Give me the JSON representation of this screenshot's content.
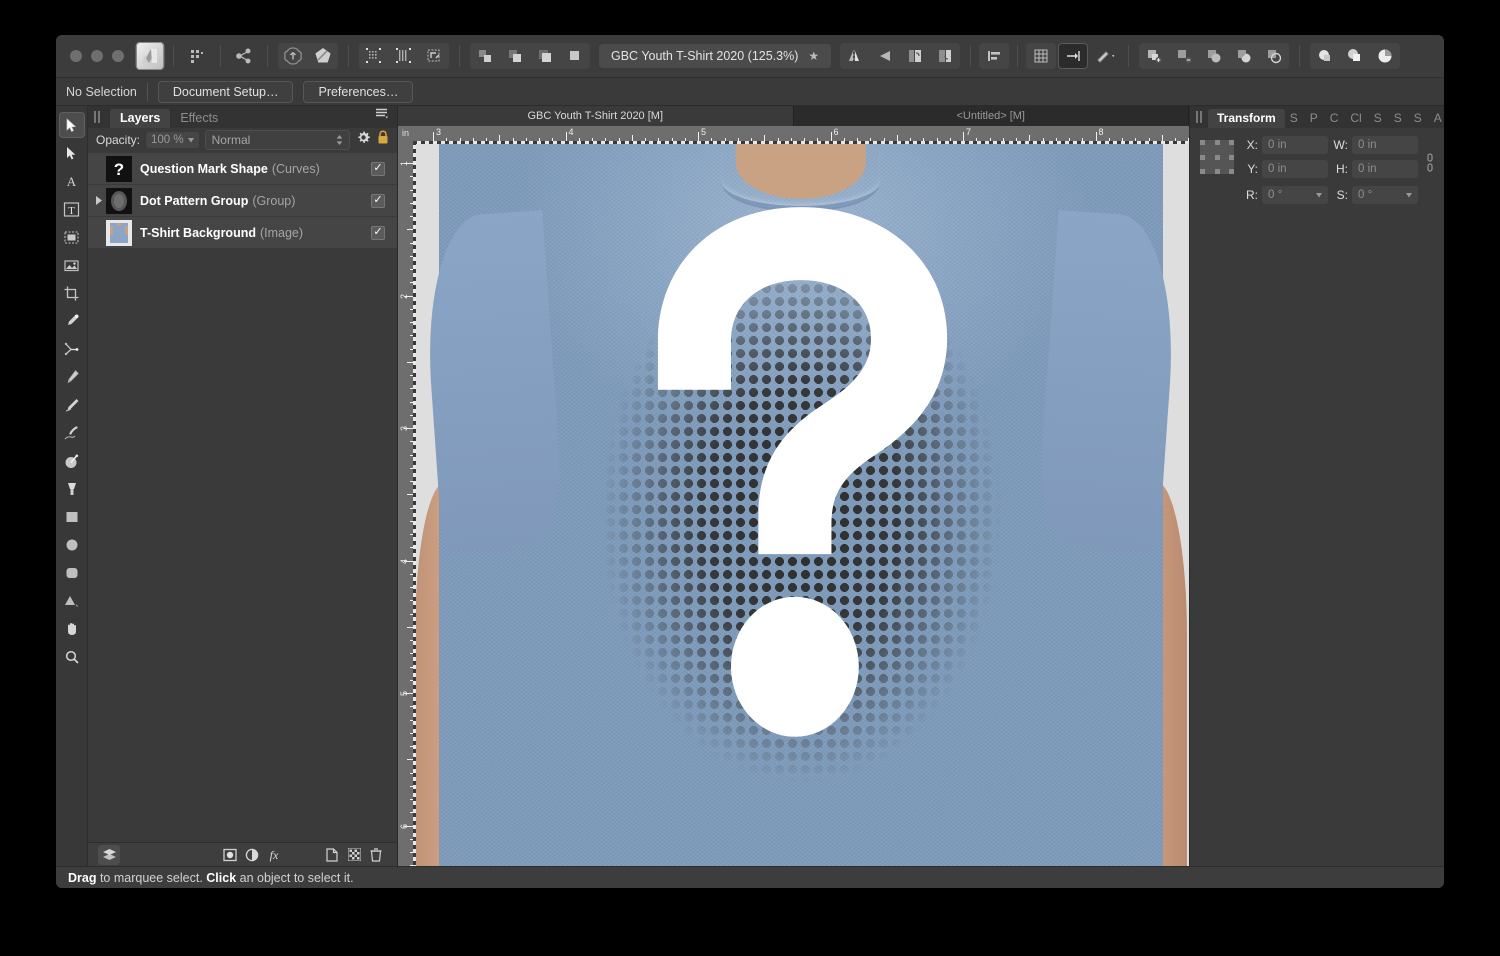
{
  "app": {
    "window_buttons": [
      "close",
      "minimize",
      "maximize"
    ],
    "logo": "affinity-photo-logo"
  },
  "titlebar": {
    "document_title": "GBC Youth T-Shirt 2020 (125.3%)",
    "modified_marker": "★",
    "tools": [
      {
        "name": "assistant-manager-icon",
        "label": "Assistant Manager"
      },
      {
        "name": "share-icon",
        "label": "Share"
      },
      {
        "name": "pixel-persona-icon",
        "label": "Pixel Persona"
      },
      {
        "name": "develop-persona-icon",
        "label": "Develop Persona"
      },
      {
        "name": "select-sampled-color-icon",
        "label": "Select Sampled Colour"
      },
      {
        "name": "refine-selection-icon",
        "label": "Refine Selection"
      },
      {
        "name": "selection-transform-icon",
        "label": "Transform Selection"
      },
      {
        "name": "boolean-add-icon",
        "label": "Add"
      },
      {
        "name": "boolean-subtract-icon",
        "label": "Subtract"
      },
      {
        "name": "boolean-intersect-icon",
        "label": "Intersect"
      },
      {
        "name": "boolean-xor-icon",
        "label": "Xor"
      },
      {
        "name": "flip-horizontal-icon",
        "label": "Flip Horizontal"
      },
      {
        "name": "flip-vertical-icon",
        "label": "Flip Vertical"
      },
      {
        "name": "rotate-ccw-icon",
        "label": "Rotate Left"
      },
      {
        "name": "rotate-cw-icon",
        "label": "Rotate Right"
      },
      {
        "name": "alignment-icon",
        "label": "Alignment"
      },
      {
        "name": "grid-snapping-icon",
        "label": "Show Grid"
      },
      {
        "name": "snapping-icon",
        "label": "Enable Snapping"
      },
      {
        "name": "snapping-options-icon",
        "label": "Snapping Options"
      },
      {
        "name": "geometry-add-icon",
        "label": "Add"
      },
      {
        "name": "geometry-subtract-icon",
        "label": "Subtract"
      },
      {
        "name": "geometry-intersect-icon",
        "label": "Intersect"
      },
      {
        "name": "geometry-divide-icon",
        "label": "Divide"
      },
      {
        "name": "geometry-combine-icon",
        "label": "Combine"
      },
      {
        "name": "merge-down-icon",
        "label": "Merge"
      },
      {
        "name": "layer-arrange-icon",
        "label": "Arrange"
      },
      {
        "name": "pie-split-icon",
        "label": "Split"
      }
    ]
  },
  "contextbar": {
    "selection_status": "No Selection",
    "document_setup": "Document Setup…",
    "preferences": "Preferences…"
  },
  "toolbox": {
    "tools": [
      {
        "name": "move-tool-icon",
        "label": "Move Tool",
        "selected": true
      },
      {
        "name": "node-tool-icon",
        "label": "Node Tool",
        "selected": false
      },
      {
        "name": "artistic-text-tool-icon",
        "label": "Artistic Text Tool",
        "selected": false
      },
      {
        "name": "frame-text-tool-icon",
        "label": "Frame Text Tool",
        "selected": false
      },
      {
        "name": "place-image-tool-icon",
        "label": "Place Image Tool",
        "selected": false
      },
      {
        "name": "picture-frame-tool-icon",
        "label": "Picture Frame Tool",
        "selected": false
      },
      {
        "name": "crop-tool-icon",
        "label": "Crop Tool",
        "selected": false
      },
      {
        "name": "color-picker-tool-icon",
        "label": "Colour Picker Tool",
        "selected": false
      },
      {
        "name": "vector-crop-tool-icon",
        "label": "Vector Crop Tool",
        "selected": false
      },
      {
        "name": "pen-tool-icon",
        "label": "Pen Tool",
        "selected": false
      },
      {
        "name": "pencil-tool-icon",
        "label": "Pencil Tool",
        "selected": false
      },
      {
        "name": "vector-brush-tool-icon",
        "label": "Vector Brush Tool",
        "selected": false
      },
      {
        "name": "fill-tool-icon",
        "label": "Fill Tool",
        "selected": false
      },
      {
        "name": "transparency-tool-icon",
        "label": "Transparency Tool",
        "selected": false
      },
      {
        "name": "rectangle-tool-icon",
        "label": "Rectangle Tool",
        "selected": false
      },
      {
        "name": "ellipse-tool-icon",
        "label": "Ellipse Tool",
        "selected": false
      },
      {
        "name": "rounded-rectangle-tool-icon",
        "label": "Rounded Rectangle Tool",
        "selected": false
      },
      {
        "name": "triangle-tool-icon",
        "label": "Triangle Tool",
        "selected": false
      },
      {
        "name": "hand-tool-icon",
        "label": "View Tool",
        "selected": false
      },
      {
        "name": "zoom-tool-icon",
        "label": "Zoom Tool",
        "selected": false
      }
    ]
  },
  "layers_panel": {
    "tabs": [
      {
        "label": "Layers",
        "active": true
      },
      {
        "label": "Effects",
        "active": false
      }
    ],
    "panel_menu_icon": "hamburger-menu-icon",
    "opacity_label": "Opacity:",
    "opacity_value": "100 %",
    "blend_mode": "Normal",
    "settings_icon": "gear-icon",
    "lock_icon": "lock-icon",
    "layers": [
      {
        "name": "Question Mark Shape",
        "kind": "(Curves)",
        "visible": true,
        "has_disclosure": false,
        "thumb": "question-mark"
      },
      {
        "name": "Dot Pattern Group",
        "kind": "(Group)",
        "visible": true,
        "has_disclosure": true,
        "thumb": "dot-gradient"
      },
      {
        "name": "T-Shirt Background",
        "kind": "(Image)",
        "visible": true,
        "has_disclosure": false,
        "thumb": "tshirt-photo"
      }
    ],
    "footer_buttons": [
      {
        "name": "layers-stack-icon",
        "label": "Layers"
      },
      {
        "name": "mask-layer-icon",
        "label": "Mask Layer"
      },
      {
        "name": "adjustment-layer-icon",
        "label": "Adjustment"
      },
      {
        "name": "live-filter-layer-icon",
        "label": "Live Filter"
      },
      {
        "name": "add-pixel-layer-icon",
        "label": "Add Pixel Layer"
      },
      {
        "name": "add-mask-layer-icon",
        "label": "Add Mask Layer"
      },
      {
        "name": "delete-layer-icon",
        "label": "Delete Layer"
      }
    ]
  },
  "document_tabs": [
    {
      "label": "GBC Youth T-Shirt 2020 [M]",
      "active": true
    },
    {
      "label": "<Untitled> [M]",
      "active": false
    }
  ],
  "rulers": {
    "unit": "in",
    "horizontal_ticks": [
      "3",
      "4",
      "5",
      "6",
      "7",
      "8"
    ],
    "vertical_ticks": [
      "1",
      "2",
      "3",
      "4",
      "5",
      "6"
    ]
  },
  "canvas": {
    "artwork_description": "Heather blue youth t-shirt photographed on a model, printed with a white question mark over a circular halftone dot gradient",
    "shirt_color": "#8aa5c6",
    "print_dot_color": "#303030",
    "question_mark_color": "#ffffff",
    "skin_color": "#c9a184",
    "backdrop_color": "#dedede"
  },
  "transform_panel": {
    "tabs": [
      {
        "label": "Transform",
        "active": true
      },
      {
        "label": "S",
        "active": false
      },
      {
        "label": "P",
        "active": false
      },
      {
        "label": "C",
        "active": false
      },
      {
        "label": "Cl",
        "active": false
      },
      {
        "label": "S",
        "active": false
      },
      {
        "label": "S",
        "active": false
      },
      {
        "label": "S",
        "active": false
      },
      {
        "label": "A",
        "active": false
      }
    ],
    "anchor_icon": "transform-anchor-icon",
    "link_icon": "link-chain-icon",
    "fields": [
      {
        "label": "X:",
        "value": "0 in",
        "stepper": false
      },
      {
        "label": "W:",
        "value": "0 in",
        "stepper": false
      },
      {
        "label": "Y:",
        "value": "0 in",
        "stepper": false
      },
      {
        "label": "H:",
        "value": "0 in",
        "stepper": false
      },
      {
        "label": "R:",
        "value": "0 °",
        "stepper": true
      },
      {
        "label": "S:",
        "value": "0 °",
        "stepper": true
      }
    ]
  },
  "statusbar": {
    "hint_prefix": "Drag",
    "hint_mid": " to marquee select. ",
    "hint_bold2": "Click",
    "hint_suffix": " an object to select it."
  }
}
